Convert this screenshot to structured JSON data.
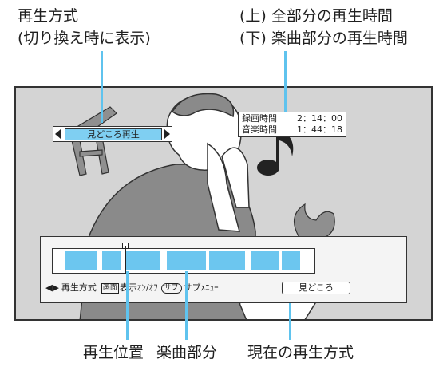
{
  "callouts": {
    "top_left_line1": "再生方式",
    "top_left_line2": "(切り換え時に表示)",
    "top_right_line1": "(上) 全部分の再生時間",
    "top_right_line2": "(下) 楽曲部分の再生時間",
    "bottom_position": "再生位置",
    "bottom_music": "楽曲部分",
    "bottom_current": "現在の再生方式"
  },
  "screen": {
    "mode_label": "見どころ再生",
    "time_rows": [
      {
        "label": "録画時間",
        "value": "2：14：00"
      },
      {
        "label": "音楽時間",
        "value": "1：44：18"
      }
    ],
    "controls": {
      "arrows_label": "再生方式",
      "display_icon": "画面",
      "display_label": "表示ｵﾝ/ｵﾌ",
      "sub_icon": "サブ",
      "sub_label": "サブﾒﾆｭｰ",
      "current_mode": "見どころ"
    },
    "progress": {
      "position_fraction": 0.28,
      "music_segments": [
        [
          0.05,
          0.17
        ],
        [
          0.19,
          0.26
        ],
        [
          0.28,
          0.41
        ],
        [
          0.44,
          0.59
        ],
        [
          0.6,
          0.74
        ],
        [
          0.76,
          0.87
        ],
        [
          0.88,
          0.95
        ]
      ]
    }
  },
  "colors": {
    "accent_blue": "#6cc6ef",
    "screen_gray": "#d4d4d4",
    "illustration_gray": "#8a8a8a"
  }
}
